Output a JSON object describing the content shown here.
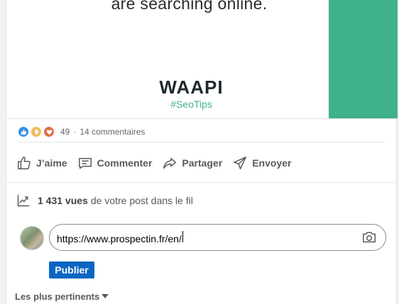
{
  "post": {
    "headline": "are searching online.",
    "logo_text": "WAAPI",
    "hashtag": "#SeoTips",
    "colors": {
      "brand_green": "#3fb28a",
      "linkedin_blue": "#0a66c2"
    }
  },
  "social": {
    "reaction_icons": [
      "like-icon",
      "insightful-icon",
      "love-icon"
    ],
    "reaction_count": "49",
    "separator": "·",
    "comments": "14 commentaires"
  },
  "actions": {
    "like": "J’aime",
    "comment": "Commenter",
    "share": "Partager",
    "send": "Envoyer"
  },
  "views": {
    "count": "1 431 vues",
    "text": "de votre post dans le fil"
  },
  "comment_box": {
    "value": "https://www.prospectin.fr/en/",
    "camera_icon": "camera-icon"
  },
  "publish_label": "Publier",
  "sort_label": "Les plus pertinents"
}
